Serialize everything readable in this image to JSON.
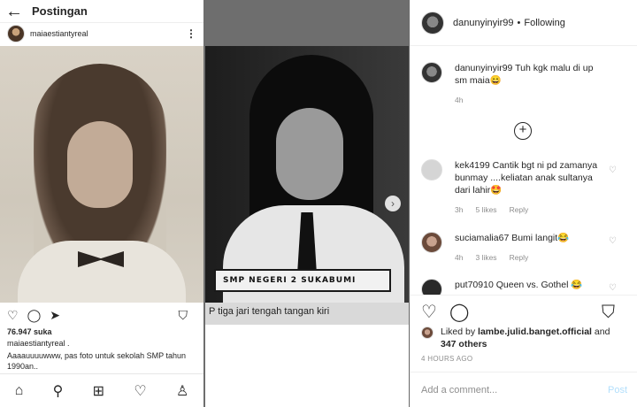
{
  "mobile": {
    "header_title": "Postingan",
    "back_icon": "←",
    "username": "maiaestiantyreal",
    "more_icon": "⋮",
    "likes": "76.947 suka",
    "caption_user": "maiaestiantyreal .",
    "caption_text": "Aaaauuuuwww, pas foto untuk sekolah SMP tahun 1990an.."
  },
  "photo_bw": {
    "plate_text": "SMP NEGERI 2 SUKABUMI",
    "lower_text": "P tiga jari tengah  tangan kiri"
  },
  "panel": {
    "header": {
      "username": "danunyinyir99",
      "separator": "•",
      "follow": "Following"
    },
    "comments": [
      {
        "user": "danunyinyir99",
        "text": "Tuh kgk malu di up sm maia😄",
        "time": "4h"
      },
      {
        "user": "kek4199",
        "text": "Cantik bgt ni pd zamanya bunmay ....keliatan anak sultanya dari lahir🤩",
        "time": "3h",
        "likes": "5 likes",
        "reply": "Reply"
      },
      {
        "user": "suciamalia67",
        "text": "Bumi langit😂",
        "time": "4h",
        "likes": "3 likes",
        "reply": "Reply"
      },
      {
        "user": "put70910",
        "text": "Queen vs. Gothel 😂"
      }
    ],
    "liked_by_prefix": "Liked by",
    "liked_by_user": "lambe.julid.banget.official",
    "liked_by_and": "and",
    "liked_by_others": "347 others",
    "time": "4 HOURS AGO",
    "comment_placeholder": "Add a comment...",
    "post_label": "Post"
  },
  "icons": {
    "heart": "♡",
    "comment": "◯",
    "share": "➤",
    "bookmark": "⛉",
    "home": "⌂",
    "search": "⚲",
    "add": "⊞",
    "profile": "♙",
    "next": "›",
    "plus": "+"
  },
  "colors": {
    "link_blue_disabled": "#b2dffc",
    "meta_gray": "#8e8e8e"
  }
}
